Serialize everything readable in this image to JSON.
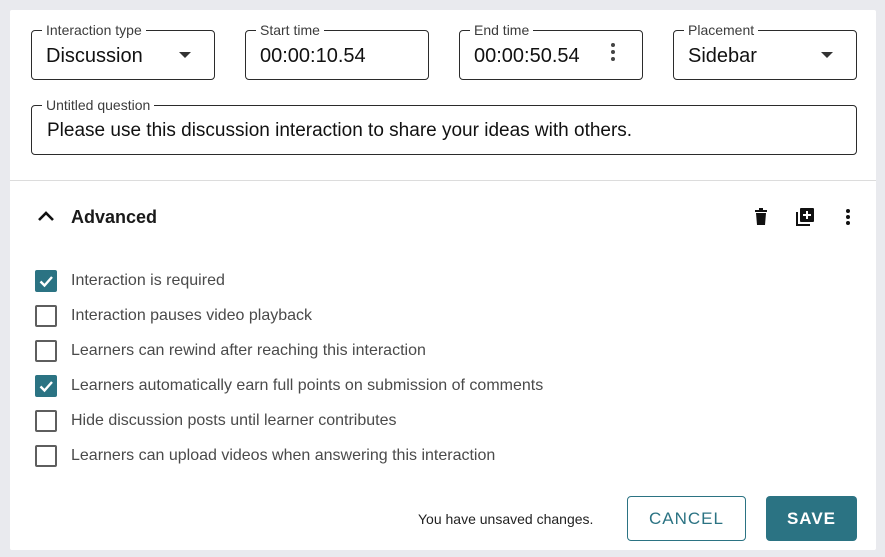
{
  "fields": {
    "interaction_type": {
      "label": "Interaction type",
      "value": "Discussion"
    },
    "start_time": {
      "label": "Start time",
      "value": "00:00:10.54"
    },
    "end_time": {
      "label": "End time",
      "value": "00:00:50.54"
    },
    "placement": {
      "label": "Placement",
      "value": "Sidebar"
    },
    "question": {
      "label": "Untitled question",
      "value": "Please use this discussion interaction to share your ideas with others."
    }
  },
  "advanced": {
    "title": "Advanced",
    "options": [
      {
        "label": "Interaction is required",
        "checked": true
      },
      {
        "label": "Interaction pauses video playback",
        "checked": false
      },
      {
        "label": "Learners can rewind after reaching this interaction",
        "checked": false
      },
      {
        "label": "Learners automatically earn full points on submission of comments",
        "checked": true
      },
      {
        "label": "Hide discussion posts until learner contributes",
        "checked": false
      },
      {
        "label": "Learners can upload videos when answering this interaction",
        "checked": false
      }
    ]
  },
  "footer": {
    "status": "You have unsaved changes.",
    "cancel_label": "CANCEL",
    "save_label": "SAVE"
  },
  "colors": {
    "accent": "#2b7383",
    "background": "#e9eaee"
  },
  "icons": [
    "chevron-up-icon",
    "trash-icon",
    "duplicate-icon",
    "more-vertical-icon",
    "dropdown-caret-icon",
    "check-icon"
  ]
}
